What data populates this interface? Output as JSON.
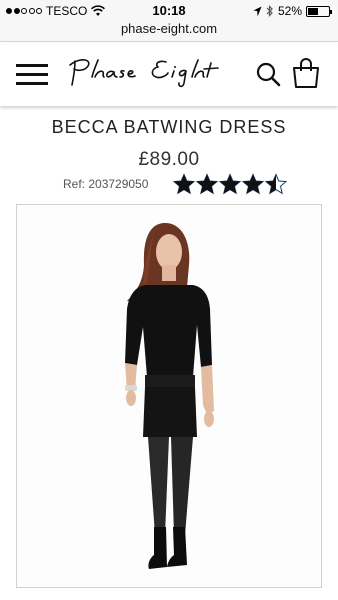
{
  "status_bar": {
    "carrier": "TESCO",
    "time": "10:18",
    "battery": "52%",
    "battery_level": 0.52
  },
  "browser": {
    "url": "phase-eight.com"
  },
  "header": {
    "logo_text": "Phase Eight",
    "menu_icon": "hamburger-menu-icon",
    "search_icon": "search-icon",
    "bag_icon": "shopping-bag-icon"
  },
  "product": {
    "title": "BECCA BATWING DRESS",
    "price": "£89.00",
    "ref": "Ref: 203729050",
    "rating": 4.5,
    "rating_max": 5
  }
}
